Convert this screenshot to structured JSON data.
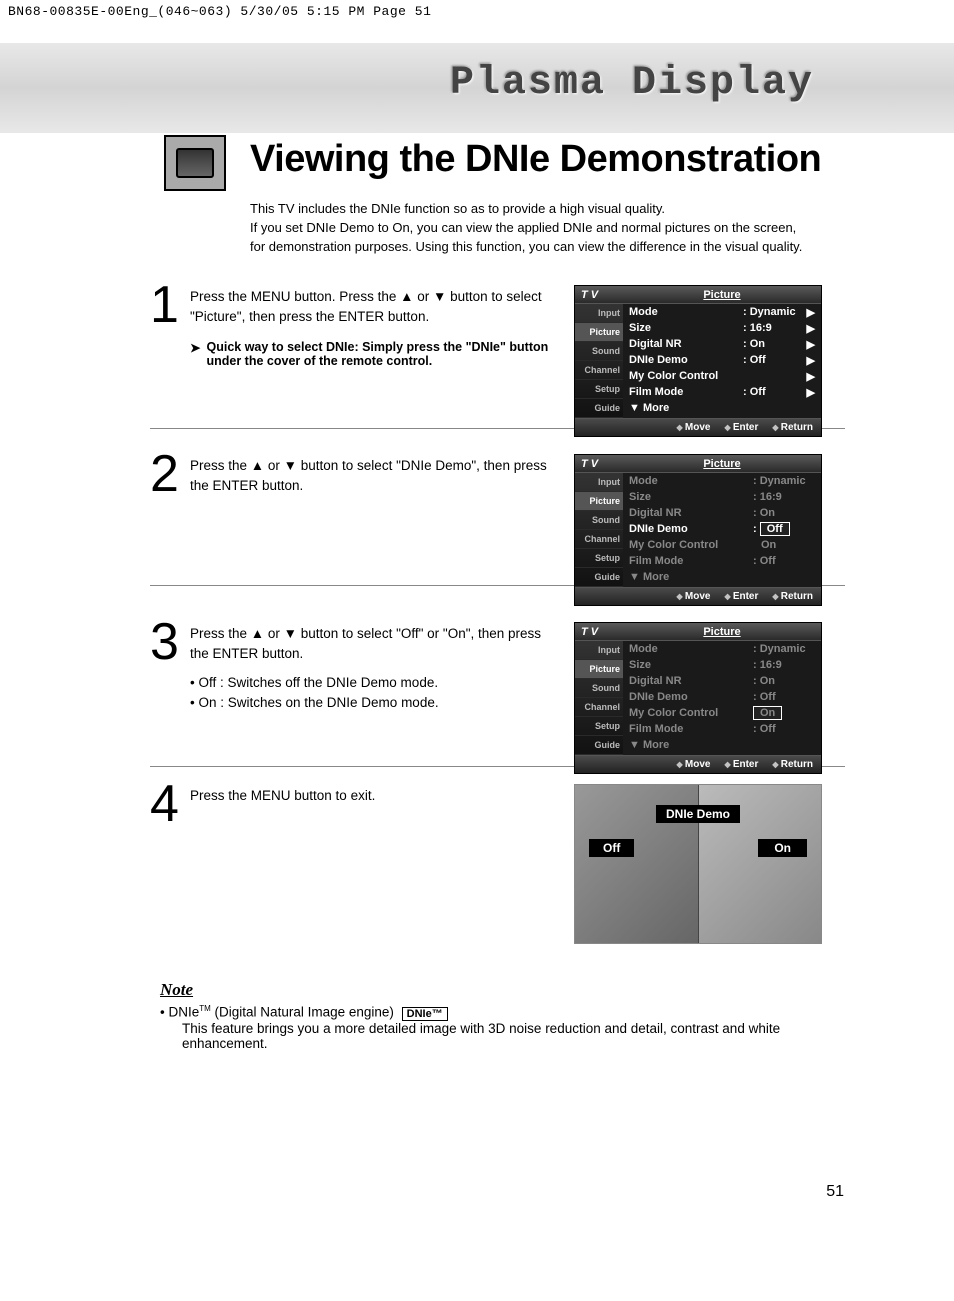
{
  "print_header": "BN68-00835E-00Eng_(046~063)  5/30/05  5:15 PM  Page 51",
  "banner_title": "Plasma Display",
  "page_title": "Viewing the DNIe Demonstration",
  "intro_line1": "This TV includes the DNIe function so as to provide a high visual quality.",
  "intro_line2": "If you set DNIe Demo to On, you can view the applied DNIe and normal pictures on the screen, for demonstration purposes. Using this function, you can view the difference in the visual quality.",
  "steps": {
    "s1": {
      "num": "1",
      "text": "Press the MENU button. Press the ▲ or ▼ button to select \"Picture\", then press the ENTER button.",
      "tip": "Quick way to select DNIe: Simply press the \"DNIe\" button under the cover of the remote control."
    },
    "s2": {
      "num": "2",
      "text": "Press the ▲ or ▼ button to select \"DNIe Demo\", then press the ENTER button."
    },
    "s3": {
      "num": "3",
      "text": "Press the ▲ or ▼ button to select \"Off\" or \"On\", then press the ENTER button.",
      "b1": "• Off : Switches off the DNIe Demo mode.",
      "b2": "• On : Switches on the DNIe Demo mode."
    },
    "s4": {
      "num": "4",
      "text": "Press the MENU button to exit."
    }
  },
  "osd_common": {
    "tv": "T V",
    "title": "Picture",
    "tabs": [
      "Input",
      "Picture",
      "Sound",
      "Channel",
      "Setup",
      "Guide"
    ],
    "foot_move": "Move",
    "foot_enter": "Enter",
    "foot_return": "Return"
  },
  "osd_rows": {
    "mode": "Mode",
    "mode_v": ": Dynamic",
    "size": "Size",
    "size_v": ": 16:9",
    "dnr": "Digital NR",
    "dnr_v": ": On",
    "dnie": "DNIe Demo",
    "dnie_v": ": Off",
    "mcc": "My Color Control",
    "film": "Film Mode",
    "film_v": ": Off",
    "more": "▼ More",
    "opt_off": "Off",
    "opt_on": "On"
  },
  "demo": {
    "title": "DNIe Demo",
    "off": "Off",
    "on": "On"
  },
  "note": {
    "heading": "Note",
    "l1a": "•   DNIe",
    "l1b": " (Digital Natural Image engine) ",
    "badge": "DNIe™",
    "l2": "This feature brings you a more detailed image with 3D noise reduction and detail, contrast and white enhancement."
  },
  "page_number": "51",
  "tm": "TM"
}
